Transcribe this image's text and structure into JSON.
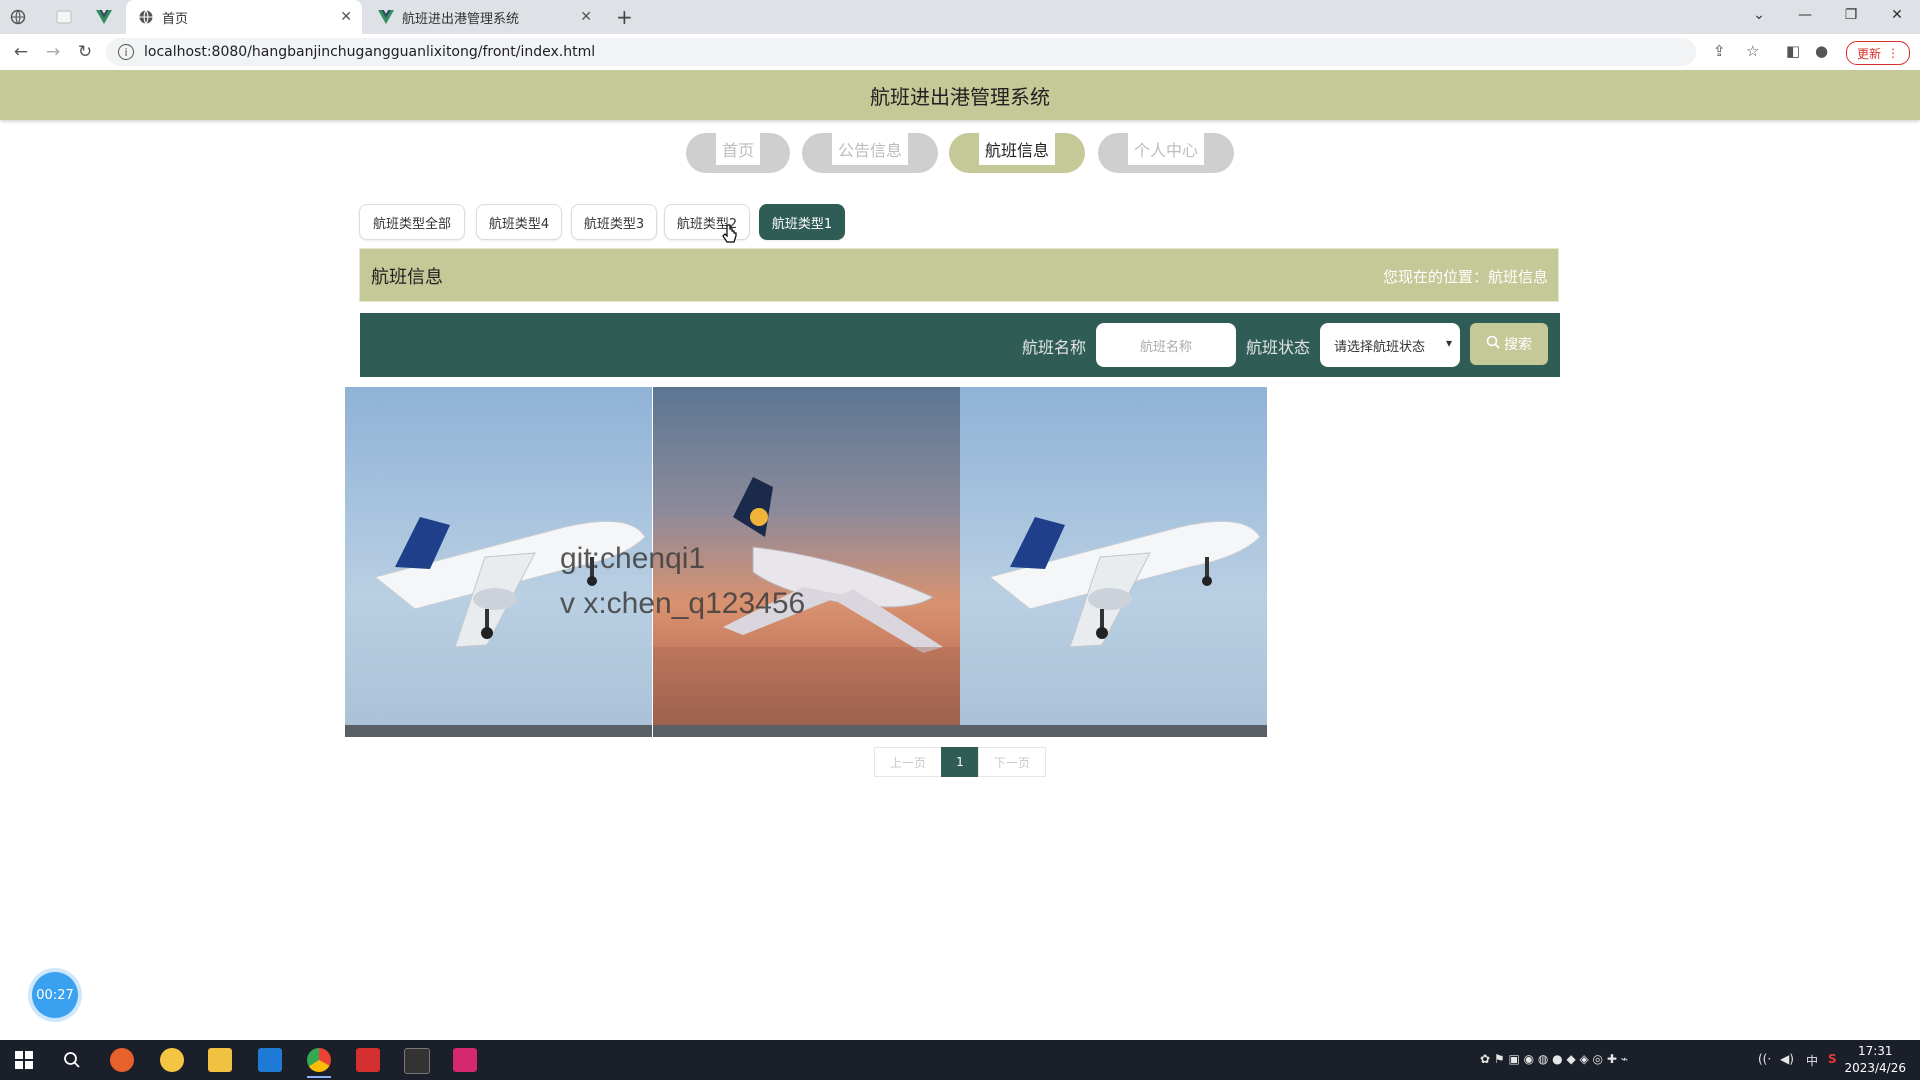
{
  "browser": {
    "tabs": [
      {
        "title": ""
      },
      {
        "title": ""
      },
      {
        "title": ""
      },
      {
        "title": "首页"
      },
      {
        "title": "航班进出港管理系统"
      }
    ],
    "url": "localhost:8080/hangbanjinchugangguanlixitong/front/index.html",
    "update_label": "更新"
  },
  "site": {
    "title": "航班进出港管理系统"
  },
  "nav": {
    "items": [
      {
        "label": "首页",
        "active": false
      },
      {
        "label": "公告信息",
        "active": false
      },
      {
        "label": "航班信息",
        "active": true
      },
      {
        "label": "个人中心",
        "active": false
      }
    ]
  },
  "types": {
    "items": [
      {
        "label": "航班类型全部",
        "active": false
      },
      {
        "label": "航班类型4",
        "active": false
      },
      {
        "label": "航班类型3",
        "active": false
      },
      {
        "label": "航班类型2",
        "active": false
      },
      {
        "label": "航班类型1",
        "active": true
      }
    ]
  },
  "section": {
    "title": "航班信息",
    "location": "您现在的位置：航班信息"
  },
  "search": {
    "name_label": "航班名称",
    "name_placeholder": "航班名称",
    "status_label": "航班状态",
    "status_selected": "请选择航班状态",
    "button_label": "搜索"
  },
  "gallery": {
    "watermark_line1": "git:chenqi1",
    "watermark_line2": "v x:chen_q123456"
  },
  "pager": {
    "prev_label": "上一页",
    "current_page": "1",
    "next_label": "下一页"
  },
  "recorder": {
    "elapsed": "00:27"
  },
  "taskbar": {
    "time": "17:31",
    "date": "2023/4/26",
    "ime": "中"
  },
  "colors": {
    "header_bg": "#c5c897",
    "accent_dark": "#2f5d55"
  }
}
